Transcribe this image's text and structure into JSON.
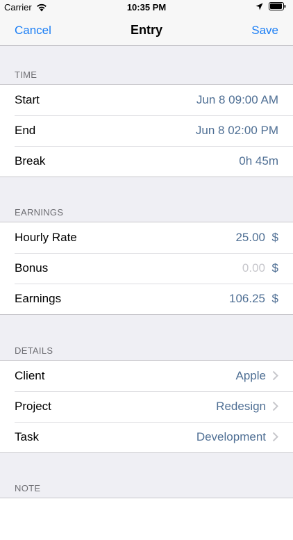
{
  "status_bar": {
    "carrier": "Carrier",
    "time": "10:35 PM"
  },
  "nav": {
    "cancel_label": "Cancel",
    "title": "Entry",
    "save_label": "Save"
  },
  "time_section": {
    "header": "TIME",
    "rows": [
      {
        "label": "Start",
        "value": "Jun 8 09:00 AM"
      },
      {
        "label": "End",
        "value": "Jun 8 02:00 PM"
      },
      {
        "label": "Break",
        "value": "0h 45m"
      }
    ]
  },
  "earnings_section": {
    "header": "EARNINGS",
    "rows": [
      {
        "label": "Hourly Rate",
        "value": "25.00",
        "unit": "$"
      },
      {
        "label": "Bonus",
        "value": "0.00",
        "unit": "$"
      },
      {
        "label": "Earnings",
        "value": "106.25",
        "unit": "$"
      }
    ]
  },
  "details_section": {
    "header": "DETAILS",
    "rows": [
      {
        "label": "Client",
        "value": "Apple"
      },
      {
        "label": "Project",
        "value": "Redesign"
      },
      {
        "label": "Task",
        "value": "Development"
      }
    ]
  },
  "note_section": {
    "header": "NOTE"
  },
  "colors": {
    "accent": "#1a7ef5",
    "value_text": "#4f6f94",
    "background": "#efeff4"
  }
}
